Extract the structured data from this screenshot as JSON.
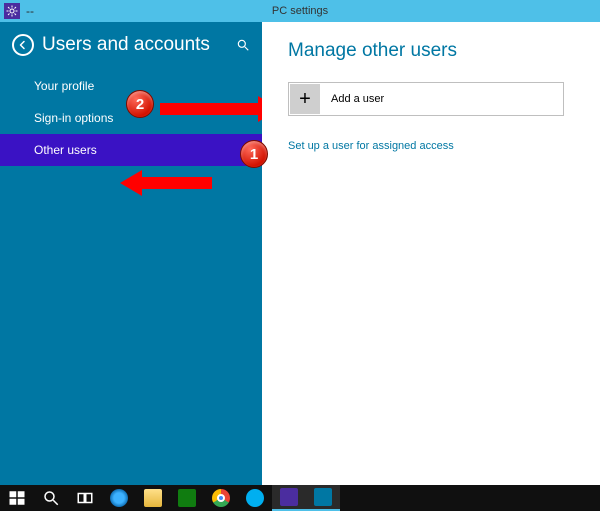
{
  "titlebar": {
    "title": "PC settings"
  },
  "sidebar": {
    "title": "Users and accounts",
    "items": [
      {
        "label": "Your profile",
        "selected": false
      },
      {
        "label": "Sign-in options",
        "selected": false
      },
      {
        "label": "Other users",
        "selected": true
      }
    ]
  },
  "main": {
    "title": "Manage other users",
    "add_user_label": "Add a user",
    "assigned_access_link": "Set up a user for assigned access"
  },
  "annotations": {
    "step1": "1",
    "step2": "2"
  },
  "taskbar": {
    "items": [
      "start",
      "search",
      "taskview",
      "ie",
      "file-explorer",
      "store",
      "chrome",
      "skype",
      "settings",
      "settings-alt"
    ]
  },
  "colors": {
    "accent": "#0077a3",
    "titlebar": "#4ec0e8",
    "selected_nav": "#3a12c4",
    "annotation_red": "#ff0000"
  }
}
